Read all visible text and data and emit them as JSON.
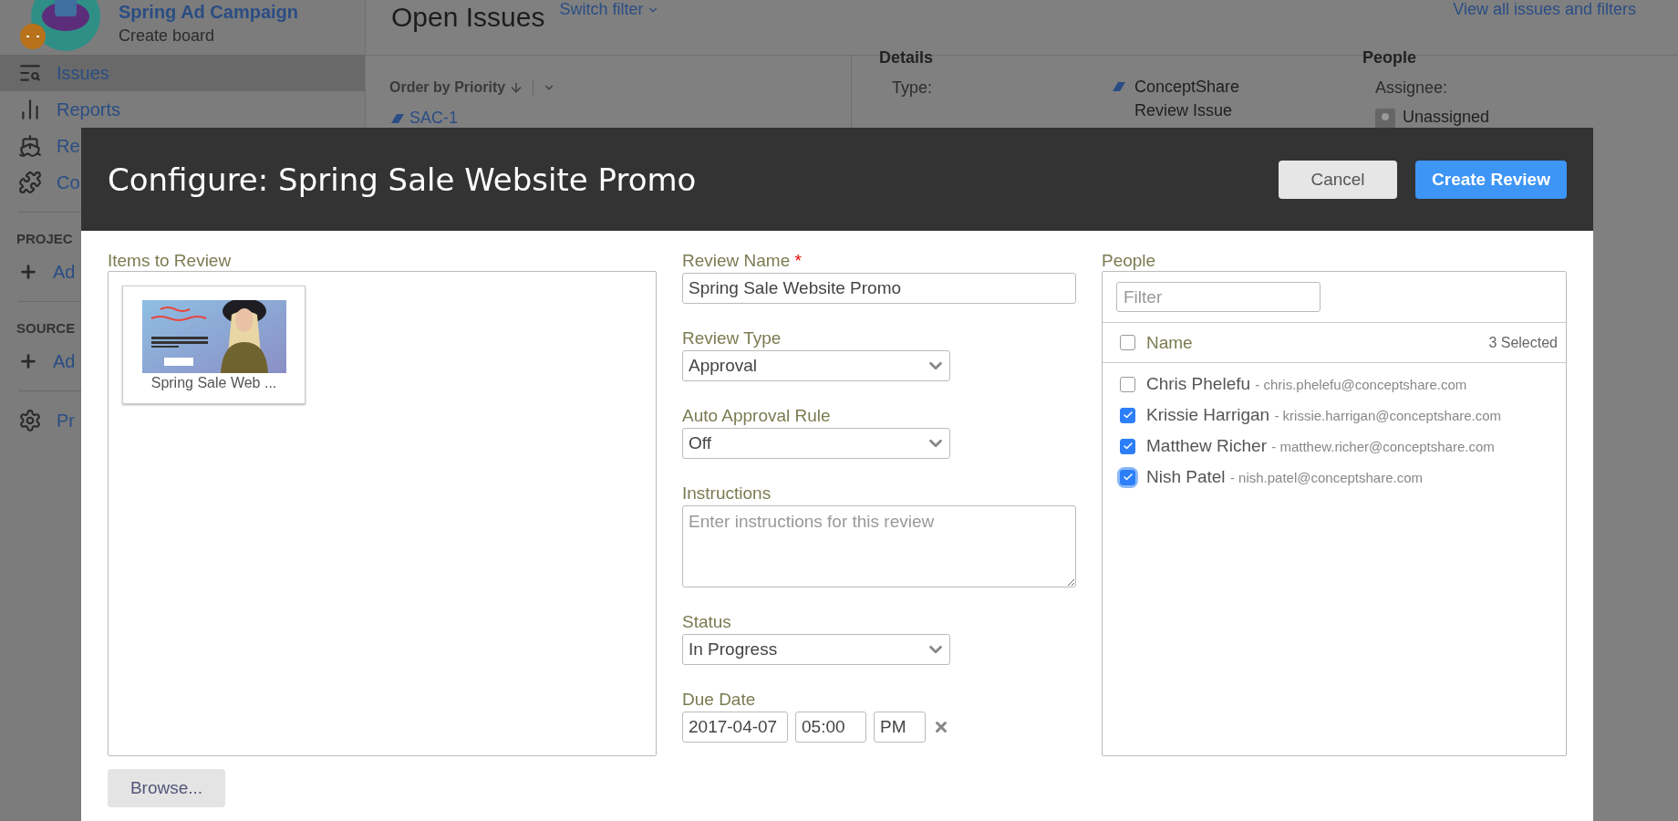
{
  "sidebar": {
    "project_name": "Spring Ad Campaign",
    "project_subtitle": "Create board",
    "items": [
      {
        "label": "Issues",
        "kind": "issues",
        "selected": true
      },
      {
        "label": "Reports",
        "kind": "reports",
        "selected": false
      },
      {
        "label": "Re",
        "kind": "ship",
        "selected": false
      },
      {
        "label": "Co",
        "kind": "puzzle",
        "selected": false
      }
    ],
    "sections": [
      {
        "heading": "PROJEC",
        "items": [
          {
            "label": "Ad",
            "kind": "add"
          }
        ]
      },
      {
        "heading": "SOURCE",
        "items": [
          {
            "label": "Ad",
            "kind": "add"
          }
        ]
      }
    ],
    "footer_items": [
      {
        "label": "Pr",
        "kind": "settings"
      }
    ]
  },
  "main": {
    "title": "Open Issues",
    "filter_link": "Switch filter",
    "view_all_link": "View all issues and filters",
    "order_by": "Order by Priority",
    "issue_key": "SAC-1",
    "details": {
      "heading": "Details",
      "type_label": "Type:",
      "type_value": "ConceptShare Review Issue"
    },
    "people": {
      "heading": "People",
      "assignee_label": "Assignee:",
      "assignee_value": "Unassigned"
    }
  },
  "dialog": {
    "title": "Configure: Spring Sale Website Promo",
    "buttons": [
      {
        "label": "Cancel",
        "kind": "secondary"
      },
      {
        "label": "Create Review",
        "kind": "primary"
      }
    ],
    "items": {
      "label": "Items to Review",
      "files": [
        {
          "name": "Spring Sale Web ...",
          "kind": "picture"
        }
      ],
      "browse": "Browse..."
    },
    "fields": [
      {
        "kind": "text",
        "label": "Review Name",
        "required_mark": "*",
        "value": "Spring Sale Website Promo"
      },
      {
        "kind": "select",
        "label": "Review Type",
        "value": "Approval"
      },
      {
        "kind": "select",
        "label": "Auto Approval Rule",
        "value": "Off"
      },
      {
        "kind": "textarea",
        "label": "Instructions",
        "placeholder": "Enter instructions for this review"
      },
      {
        "kind": "select",
        "label": "Status",
        "value": "In Progress"
      },
      {
        "kind": "datetime",
        "label": "Due Date",
        "date": "2017-04-07",
        "time": "05:00",
        "meridiem": "PM"
      }
    ],
    "people": {
      "label": "People",
      "filter_placeholder": "Filter",
      "header": {
        "label": "Name",
        "checked": false,
        "count": "3 Selected"
      },
      "rows": [
        {
          "name": "Chris Phelefu",
          "email": "- chris.phelefu@conceptshare.com",
          "checked": false
        },
        {
          "name": "Krissie Harrigan",
          "email": "- krissie.harrigan@conceptshare.com",
          "checked": true
        },
        {
          "name": "Matthew Richer",
          "email": "- matthew.richer@conceptshare.com",
          "checked": true
        },
        {
          "name": "Nish Patel",
          "email": "- nish.patel@conceptshare.com",
          "checked": true,
          "focused": true
        }
      ]
    }
  }
}
